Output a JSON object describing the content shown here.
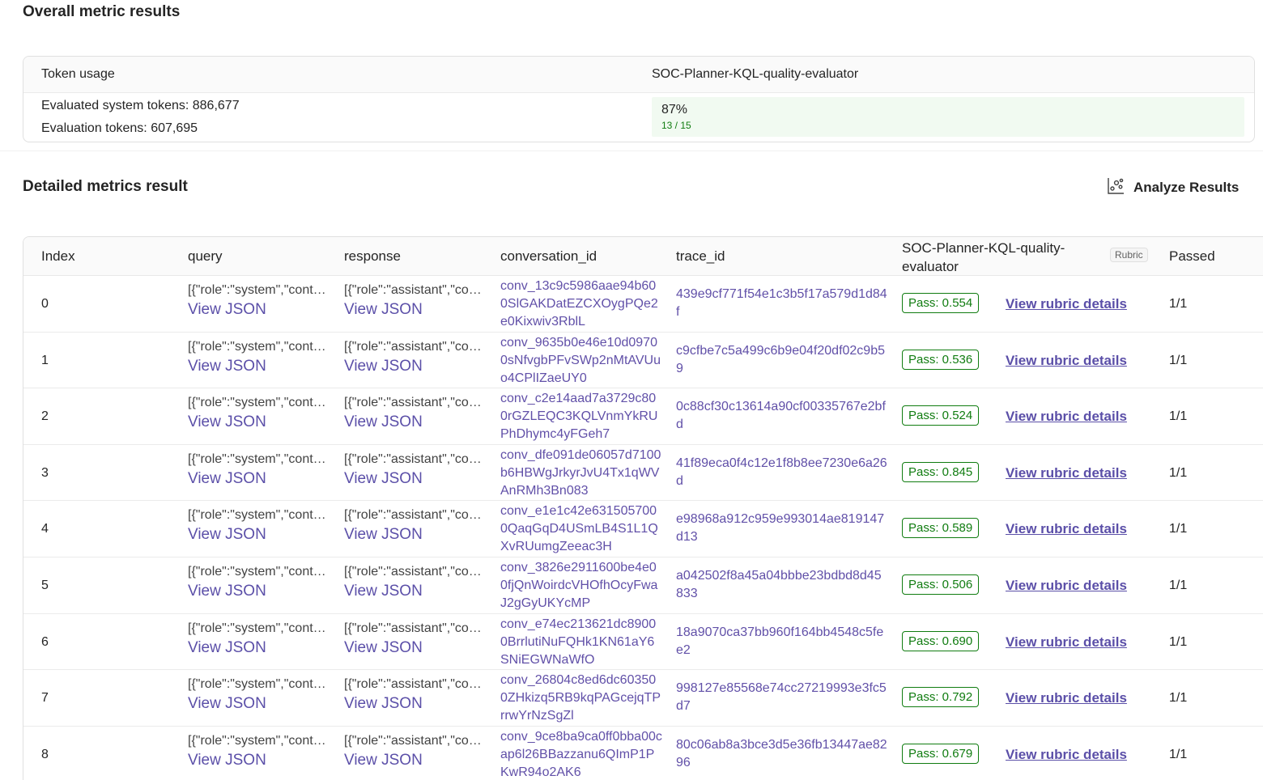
{
  "overall": {
    "title": "Overall metric results",
    "token_header": "Token usage",
    "evaluator_header": "SOC-Planner-KQL-quality-evaluator",
    "system_tokens": "Evaluated system tokens: 886,677",
    "eval_tokens": "Evaluation tokens: 607,695",
    "score_percent": "87%",
    "score_fraction": "13 / 15"
  },
  "detailed": {
    "title": "Detailed metrics result",
    "analyze_label": "Analyze Results"
  },
  "table": {
    "headers": {
      "index": "Index",
      "query": "query",
      "response": "response",
      "conversation_id": "conversation_id",
      "trace_id": "trace_id",
      "evaluator": "SOC-Planner-KQL-quality-evaluator",
      "rubric_tag": "Rubric",
      "passed": "Passed"
    },
    "view_json_label": "View JSON",
    "rubric_link_label": "View rubric details",
    "rows": [
      {
        "index": "0",
        "query": "[{\"role\":\"system\",\"content\"",
        "response": "[{\"role\":\"assistant\",\"content\"",
        "conversation_id": "conv_13c9c5986aae94b600SlGAKDatEZCXOygPQe2e0Kixwiv3RblL",
        "trace_id": "439e9cf771f54e1c3b5f17a579d1d84f",
        "badge": "Pass: 0.554",
        "passed": "1/1"
      },
      {
        "index": "1",
        "query": "[{\"role\":\"system\",\"content\"",
        "response": "[{\"role\":\"assistant\",\"content\"",
        "conversation_id": "conv_9635b0e46e10d09700sNfvgbPFvSWp2nMtAVUuo4CPlIZaeUY0",
        "trace_id": "c9cfbe7c5a499c6b9e04f20df02c9b59",
        "badge": "Pass: 0.536",
        "passed": "1/1"
      },
      {
        "index": "2",
        "query": "[{\"role\":\"system\",\"content\"",
        "response": "[{\"role\":\"assistant\",\"content\"",
        "conversation_id": "conv_c2e14aad7a3729c800rGZLEQC3KQLVnmYkRUPhDhymc4yFGeh7",
        "trace_id": "0c88cf30c13614a90cf00335767e2bfd",
        "badge": "Pass: 0.524",
        "passed": "1/1"
      },
      {
        "index": "3",
        "query": "[{\"role\":\"system\",\"content\"",
        "response": "[{\"role\":\"assistant\",\"content\"",
        "conversation_id": "conv_dfe091de06057d7100b6HBWgJrkyrJvU4Tx1qWVAnRMh3Bn083",
        "trace_id": "41f89eca0f4c12e1f8b8ee7230e6a26d",
        "badge": "Pass: 0.845",
        "passed": "1/1"
      },
      {
        "index": "4",
        "query": "[{\"role\":\"system\",\"content\"",
        "response": "[{\"role\":\"assistant\",\"content\"",
        "conversation_id": "conv_e1e1c42e6315057000QaqGqD4USmLB4S1L1QXvRUumgZeeac3H",
        "trace_id": "e98968a912c959e993014ae819147d13",
        "badge": "Pass: 0.589",
        "passed": "1/1"
      },
      {
        "index": "5",
        "query": "[{\"role\":\"system\",\"content\"",
        "response": "[{\"role\":\"assistant\",\"content\"",
        "conversation_id": "conv_3826e2911600be4e00fjQnWoirdcVHOfhOcyFwaJ2gGyUKYcMP",
        "trace_id": "a042502f8a45a04bbbe23bdbd8d45833",
        "badge": "Pass: 0.506",
        "passed": "1/1"
      },
      {
        "index": "6",
        "query": "[{\"role\":\"system\",\"content\"",
        "response": "[{\"role\":\"assistant\",\"content\"",
        "conversation_id": "conv_e74ec213621dc89000BrrlutiNuFQHk1KN61aY6SNiEGWNaWfO",
        "trace_id": "18a9070ca37bb960f164bb4548c5fee2",
        "badge": "Pass: 0.690",
        "passed": "1/1"
      },
      {
        "index": "7",
        "query": "[{\"role\":\"system\",\"content\"",
        "response": "[{\"role\":\"assistant\",\"content\"",
        "conversation_id": "conv_26804c8ed6dc603500ZHkizq5RB9kqPAGcejqTPrrwYrNzSgZl",
        "trace_id": "998127e85568e74cc27219993e3fc5d7",
        "badge": "Pass: 0.792",
        "passed": "1/1"
      },
      {
        "index": "8",
        "query": "[{\"role\":\"system\",\"content\"",
        "response": "[{\"role\":\"assistant\",\"content\"",
        "conversation_id": "conv_9ce8ba9ca0ff0bba00cap6l26BBazzanu6QImP1PKwR94o2AK6",
        "trace_id": "80c06ab8a3bce3d5e36fb13447ae8296",
        "badge": "Pass: 0.679",
        "passed": "1/1"
      }
    ]
  },
  "colors": {
    "link": "#5b4fa8",
    "pass_green": "#107c10",
    "score_bg": "#f1faf1"
  }
}
